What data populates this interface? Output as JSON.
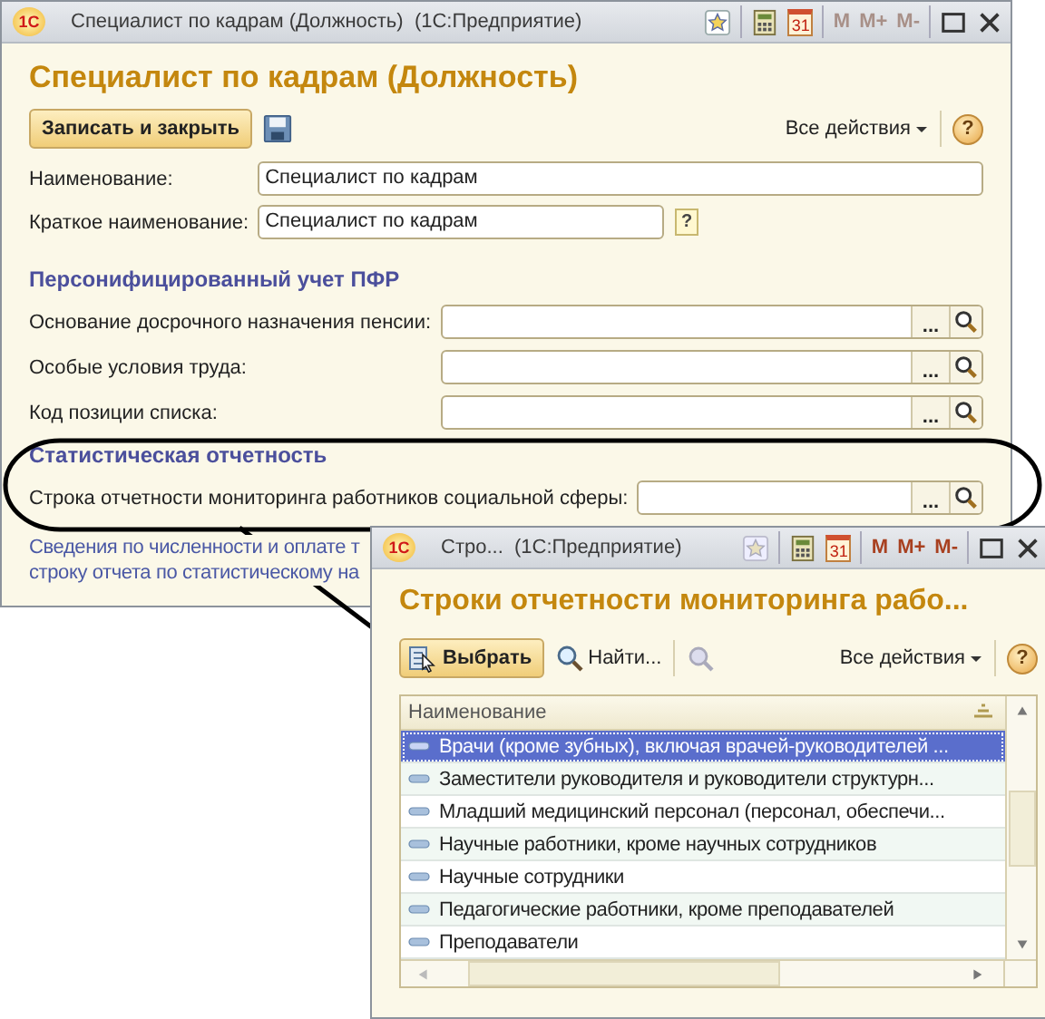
{
  "main_window": {
    "logo": "1С",
    "title": "Специалист по кадрам (Должность)  (1С:Предприятие)",
    "calendar_day": "31",
    "memory_buttons": [
      {
        "label": "M",
        "disabled": true
      },
      {
        "label": "M+",
        "disabled": true
      },
      {
        "label": "M-",
        "disabled": true
      }
    ],
    "heading": "Специалист по кадрам (Должность)",
    "save_button": "Записать и закрыть",
    "all_actions": "Все действия",
    "help": "?",
    "fields": [
      {
        "label": "Наименование:",
        "value": "Специалист по кадрам",
        "kind": "text"
      },
      {
        "label": "Краткое наименование:",
        "value": "Специалист по кадрам",
        "kind": "short",
        "hint": "?"
      }
    ],
    "sections": [
      {
        "title": "Персонифицированный учет ПФР",
        "fields": [
          {
            "label": "Основание досрочного назначения пенсии:",
            "button": "..."
          },
          {
            "label": "Особые условия труда:",
            "button": "..."
          },
          {
            "label": "Код позиции списка:",
            "button": "..."
          }
        ]
      },
      {
        "title": "Статистическая отчетность",
        "fields": [
          {
            "label": "Строка отчетности мониторинга работников социальной сферы:",
            "button": "..."
          }
        ]
      }
    ],
    "note_lines": [
      "Сведения по численности и оплате т",
      "строку отчета по статистическому на"
    ]
  },
  "popup_window": {
    "logo": "1С",
    "title": "Стро...  (1С:Предприятие)",
    "calendar_day": "31",
    "memory_buttons": [
      {
        "label": "M",
        "disabled": false
      },
      {
        "label": "M+",
        "disabled": false
      },
      {
        "label": "M-",
        "disabled": false
      }
    ],
    "heading": "Строки отчетности мониторинга рабо...",
    "choose_button": "Выбрать",
    "find_button": "Найти...",
    "all_actions": "Все действия",
    "help": "?",
    "table": {
      "column": "Наименование",
      "rows": [
        {
          "text": "Врачи (кроме зубных), включая врачей-руководителей ...",
          "selected": true
        },
        {
          "text": "Заместители руководителя и руководители структурн...",
          "selected": false
        },
        {
          "text": "Младший медицинский персонал (персонал, обеспечи...",
          "selected": false
        },
        {
          "text": "Научные работники, кроме научных сотрудников",
          "selected": false
        },
        {
          "text": "Научные сотрудники",
          "selected": false
        },
        {
          "text": "Педагогические работники, кроме преподавателей",
          "selected": false
        },
        {
          "text": "Преподаватели",
          "selected": false
        }
      ]
    }
  }
}
